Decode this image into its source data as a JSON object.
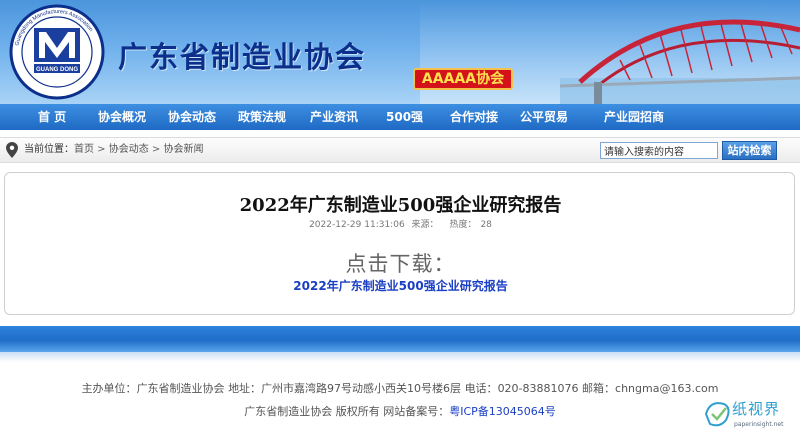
{
  "header": {
    "org_title": "广东省制造业协会",
    "badge": "AAAAA协会",
    "logo_text": "GUANG DONG",
    "logo_ring_text": "Guangdong Manufacturers Association",
    "colors": {
      "banner": "#4b95dc",
      "title": "#0b2f8a",
      "badge_bg": "#d4121a",
      "badge_text": "#ffe24d"
    }
  },
  "nav": {
    "items": [
      {
        "label": "首 页"
      },
      {
        "label": "协会概况"
      },
      {
        "label": "协会动态"
      },
      {
        "label": "政策法规"
      },
      {
        "label": "产业资讯"
      },
      {
        "label": "500强"
      },
      {
        "label": "合作对接"
      },
      {
        "label": "公平贸易"
      },
      {
        "label": "产业园招商"
      }
    ]
  },
  "breadcrumb": {
    "label": "当前位置：",
    "items": [
      "首页",
      "协会动态",
      "协会新闻"
    ],
    "separator": " > "
  },
  "search": {
    "placeholder": "请输入搜索的内容",
    "value": "请输入搜索的内容",
    "button": "站内检索"
  },
  "article": {
    "title": "2022年广东制造业500强企业研究报告",
    "date": "2022-12-29 11:31:06",
    "source_label": "来源：",
    "source_value": "",
    "views_label": "热度：",
    "views_value": "28",
    "download_heading": "点击下载：",
    "download_link": "2022年广东制造业500强企业研究报告"
  },
  "footer": {
    "host_label": "主办单位：",
    "host": "广东省制造业协会",
    "address_label": "地址：",
    "address": "广州市嘉湾路97号动感小西关10号楼6层",
    "phone_label": "电话：",
    "phone": "020-83881076",
    "email_label": "邮箱：",
    "email": "chngma@163.com",
    "copyright": "广东省制造业协会 版权所有 网站备案号：",
    "icp": "粤ICP备13045064号"
  },
  "watermark": {
    "text": "纸视界",
    "url": "paperinsight.net"
  }
}
